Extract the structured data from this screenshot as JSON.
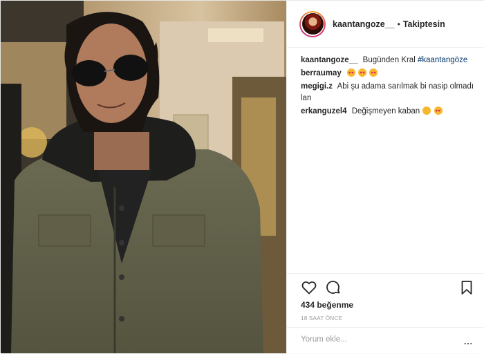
{
  "header": {
    "username": "kaantangoze__",
    "separator": "•",
    "follow_label": "Takiptesin"
  },
  "caption": {
    "user": "kaantangoze__",
    "text": "Bugünden Kral",
    "hashtag": "#kaantangöze"
  },
  "comments": [
    {
      "user": "berraumay",
      "text": "",
      "emojis": [
        "heart-eyes",
        "heart-eyes",
        "heart-eyes"
      ]
    },
    {
      "user": "megigi.z",
      "text": "Abi şu adama sarılmak bi nasip olmadı lan",
      "emojis": []
    },
    {
      "user": "erkanguzel4",
      "text": "Değişmeyen kaban",
      "emojis": [
        "kissing",
        "heart-eyes"
      ]
    }
  ],
  "actions": {
    "like_icon": "heart-icon",
    "comment_icon": "comment-icon",
    "save_icon": "bookmark-icon"
  },
  "likes_label": "434 beğenme",
  "time_label": "18 SAAT ÖNCE",
  "add_comment": {
    "placeholder": "Yorum ekle...",
    "more_label": "..."
  }
}
